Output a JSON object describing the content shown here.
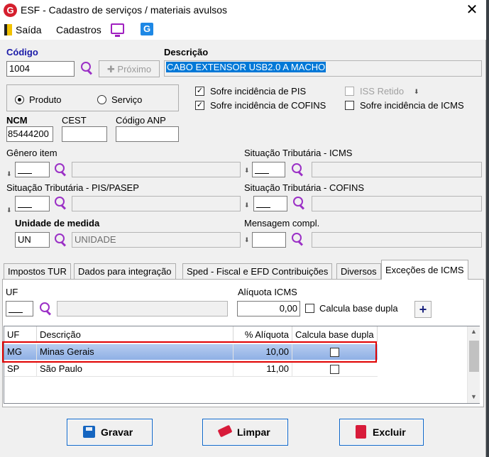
{
  "window": {
    "title": "ESF - Cadastro de serviços / materiais avulsos",
    "close": "✕",
    "logo": "G"
  },
  "menu": {
    "exit": "Saída",
    "cadastros": "Cadastros",
    "g_logo": "G"
  },
  "codigo": {
    "label": "Código",
    "value": "1004",
    "proximo": "Próximo",
    "proximo_plus": "✚"
  },
  "descricao": {
    "label": "Descrição",
    "value": "CABO EXTENSOR USB2.0 A MACHO"
  },
  "tipo": {
    "produto": "Produto",
    "servico": "Serviço",
    "selected": "Produto"
  },
  "checks": {
    "pis": {
      "label": "Sofre incidência de PIS",
      "checked": true
    },
    "cofins": {
      "label": "Sofre incidência de COFINS",
      "checked": true
    },
    "iss": {
      "label": "ISS Retido",
      "checked": false
    },
    "icms": {
      "label": "Sofre incidência de ICMS",
      "checked": false
    }
  },
  "ncm": {
    "label": "NCM",
    "value": "85444200"
  },
  "cest": {
    "label": "CEST",
    "value": ""
  },
  "anp": {
    "label": "Código ANP",
    "value": ""
  },
  "genero": {
    "label": "Gênero item"
  },
  "st_icms": {
    "label": "Situação Tributária - ICMS"
  },
  "st_pis": {
    "label": "Situação Tributária - PIS/PASEP"
  },
  "st_cofins": {
    "label": "Situação Tributária - COFINS"
  },
  "unidade": {
    "label": "Unidade de medida",
    "code": "UN",
    "desc": "UNIDADE"
  },
  "mensagem": {
    "label": "Mensagem compl."
  },
  "tabs": [
    "Impostos TUR",
    "Dados para integração",
    "Sped - Fiscal e EFD Contribuições",
    "Diversos",
    "Exceções de ICMS"
  ],
  "excecoes": {
    "uf_label": "UF",
    "aliquota_label": "Alíquota ICMS",
    "aliquota_value": "0,00",
    "base_dupla_label": "Calcula base dupla",
    "add": "+"
  },
  "grid": {
    "headers": [
      "UF",
      "Descrição",
      "% Alíquota",
      "Calcula base dupla"
    ],
    "rows": [
      {
        "uf": "MG",
        "desc": "Minas Gerais",
        "aliq": "10,00",
        "dupla": false
      },
      {
        "uf": "SP",
        "desc": "São Paulo",
        "aliq": "11,00",
        "dupla": false
      }
    ],
    "scroll_up": "▲",
    "scroll_down": "▼"
  },
  "buttons": {
    "gravar": "Gravar",
    "limpar": "Limpar",
    "excluir": "Excluir"
  }
}
